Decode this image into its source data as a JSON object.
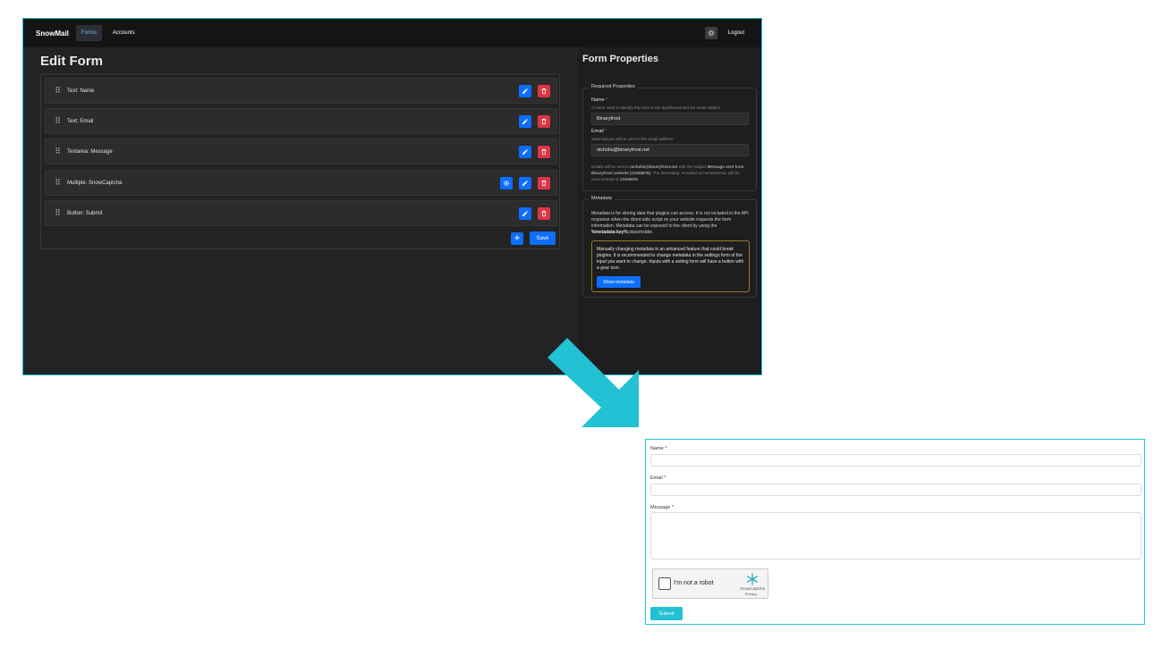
{
  "navbar": {
    "brand": "SnowMail",
    "links": [
      "Forms",
      "Accounts"
    ],
    "theme_icon": "sun-icon",
    "logout": "Logout"
  },
  "editor": {
    "title": "Edit Form",
    "inputs": [
      {
        "label": "Text: Name",
        "has_settings": false
      },
      {
        "label": "Text: Email",
        "has_settings": false
      },
      {
        "label": "Textarea: Message",
        "has_settings": false
      },
      {
        "label": "Multiple: SnowCaptcha",
        "has_settings": true
      },
      {
        "label": "Button: Submit",
        "has_settings": false
      }
    ],
    "add_icon": "plus-icon",
    "save_label": "Save"
  },
  "properties": {
    "title": "Form Properties",
    "required_legend": "Required Properties",
    "name_label": "Name",
    "required_mark": "*",
    "name_help": "A name used to identify this form in the dashboard and the email subject",
    "name_value": "Binaryfrost",
    "email_label": "Email",
    "email_help": "Submissions will be sent to this email address",
    "email_value": "nicholis@binaryfrost.net",
    "note_1": "Emails will be sent to ",
    "note_email": "nicholis@binaryfrost.net",
    "note_2": " with the subject ",
    "note_subject": "Message sent from Binaryfrost website (12345678)",
    "note_3": ". The timestamp, encoded as hexadecimal, will be used instead of ",
    "note_ts": "12345678",
    "note_4": ".",
    "metadata_legend": "Metadata",
    "metadata_text_1": "Metadata is for storing data that plugins can access. It is not included in the API response when the client-side script on your website requests the form information. Metadata can be exposed to the client by using the ",
    "metadata_placeholder": "%metadata:key%",
    "metadata_text_2": " placeholder.",
    "warning_text": "Manually changing metadata is an advanced feature that could break plugins. It is recommended to change metadata in the settings form of the input you want to change. Inputs with a setting form will have a button with a gear icon.",
    "show_metadata": "Show metadata"
  },
  "preview": {
    "name_label": "Name",
    "email_label": "Email",
    "message_label": "Message",
    "required_mark": "*",
    "captcha_text": "I'm not a robot",
    "captcha_brand": "SnowCaptcha",
    "captcha_privacy": "Privacy",
    "submit_label": "Submit"
  },
  "colors": {
    "accent_border": "#27c4d4",
    "primary_button": "#0d6efd",
    "danger_button": "#dc3545",
    "submit_button": "#22c1d4"
  }
}
